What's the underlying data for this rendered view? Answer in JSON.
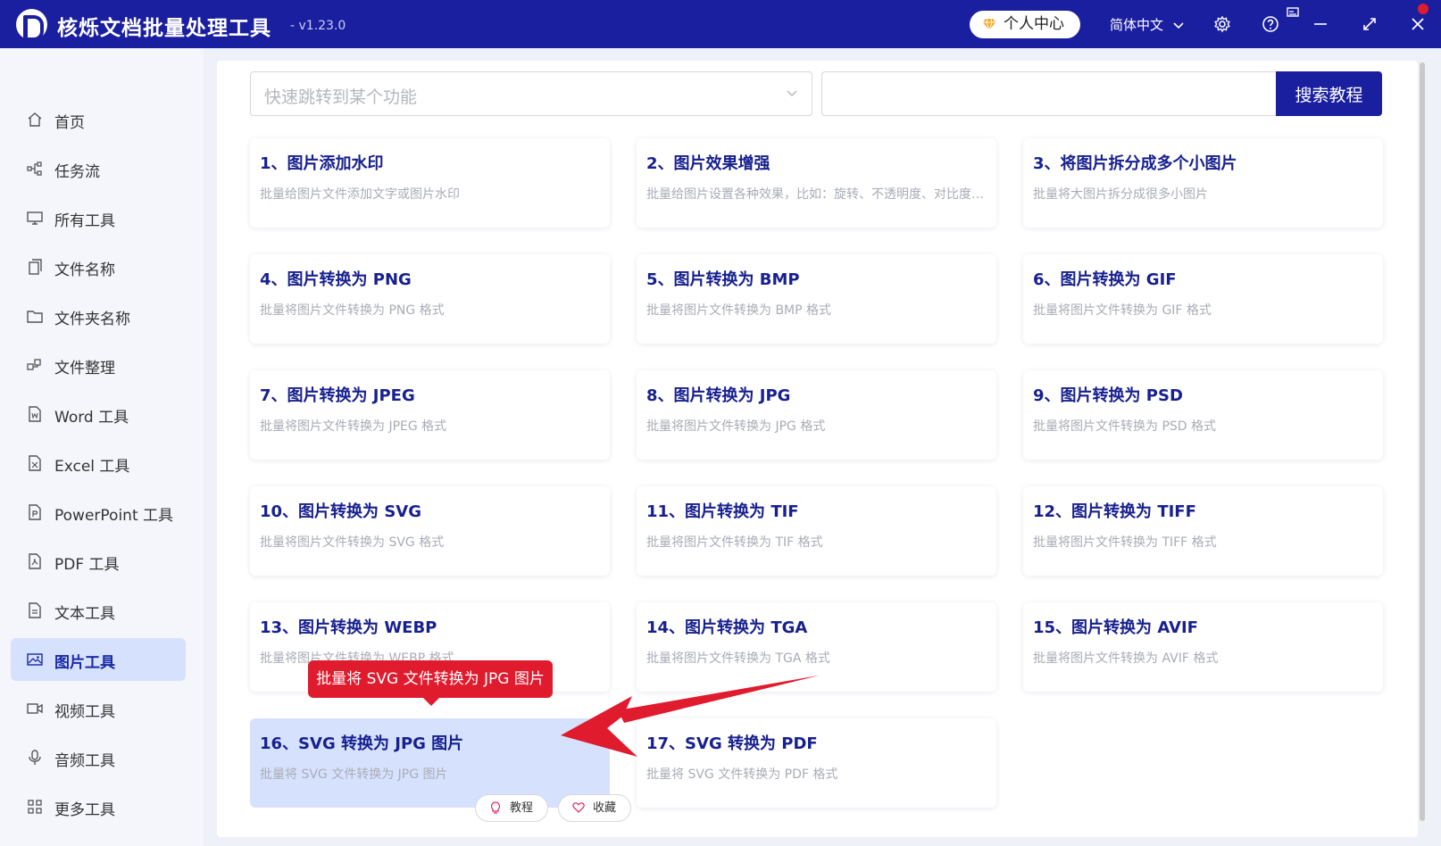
{
  "app": {
    "title": "核烁文档批量处理工具",
    "version": "- v1.23.0",
    "profile_label": "个人中心",
    "language": "简体中文"
  },
  "sidebar": {
    "items": [
      {
        "label": "首页",
        "icon": "home-icon"
      },
      {
        "label": "任务流",
        "icon": "workflow-icon"
      },
      {
        "label": "所有工具",
        "icon": "monitor-icon"
      },
      {
        "label": "文件名称",
        "icon": "file-copy-icon"
      },
      {
        "label": "文件夹名称",
        "icon": "folder-icon"
      },
      {
        "label": "文件整理",
        "icon": "organize-icon"
      },
      {
        "label": "Word 工具",
        "icon": "word-file-icon"
      },
      {
        "label": "Excel 工具",
        "icon": "excel-file-icon"
      },
      {
        "label": "PowerPoint 工具",
        "icon": "ppt-file-icon"
      },
      {
        "label": "PDF 工具",
        "icon": "pdf-file-icon"
      },
      {
        "label": "文本工具",
        "icon": "text-file-icon"
      },
      {
        "label": "图片工具",
        "icon": "image-icon",
        "active": true
      },
      {
        "label": "视频工具",
        "icon": "video-icon"
      },
      {
        "label": "音频工具",
        "icon": "microphone-icon"
      },
      {
        "label": "更多工具",
        "icon": "grid-icon"
      }
    ]
  },
  "search": {
    "select_placeholder": "快速跳转到某个功能",
    "input_value": "",
    "button_label": "搜索教程"
  },
  "cards": [
    {
      "title": "1、图片添加水印",
      "desc": "批量给图片文件添加文字或图片水印"
    },
    {
      "title": "2、图片效果增强",
      "desc": "批量给图片设置各种效果，比如：旋转、不透明度、对比度、亮度等"
    },
    {
      "title": "3、将图片拆分成多个小图片",
      "desc": "批量将大图片拆分成很多小图片"
    },
    {
      "title": "4、图片转换为 PNG",
      "desc": "批量将图片文件转换为 PNG 格式"
    },
    {
      "title": "5、图片转换为 BMP",
      "desc": "批量将图片文件转换为 BMP 格式"
    },
    {
      "title": "6、图片转换为 GIF",
      "desc": "批量将图片文件转换为 GIF 格式"
    },
    {
      "title": "7、图片转换为 JPEG",
      "desc": "批量将图片文件转换为 JPEG 格式"
    },
    {
      "title": "8、图片转换为 JPG",
      "desc": "批量将图片文件转换为 JPG 格式"
    },
    {
      "title": "9、图片转换为 PSD",
      "desc": "批量将图片文件转换为 PSD 格式"
    },
    {
      "title": "10、图片转换为 SVG",
      "desc": "批量将图片文件转换为 SVG 格式"
    },
    {
      "title": "11、图片转换为 TIF",
      "desc": "批量将图片文件转换为 TIF 格式"
    },
    {
      "title": "12、图片转换为 TIFF",
      "desc": "批量将图片文件转换为 TIFF 格式"
    },
    {
      "title": "13、图片转换为 WEBP",
      "desc": "批量将图片文件转换为 WEBP 格式"
    },
    {
      "title": "14、图片转换为 TGA",
      "desc": "批量将图片文件转换为 TGA 格式"
    },
    {
      "title": "15、图片转换为 AVIF",
      "desc": "批量将图片文件转换为 AVIF 格式"
    },
    {
      "title": "16、SVG 转换为 JPG 图片",
      "desc": "批量将 SVG 文件转换为 JPG 图片",
      "highlighted": true
    },
    {
      "title": "17、SVG 转换为 PDF",
      "desc": "批量将 SVG 文件转换为 PDF 格式"
    }
  ],
  "card_actions": {
    "tutorial_label": "教程",
    "favorite_label": "收藏"
  },
  "tooltip": {
    "text": "批量将 SVG 文件转换为 JPG 图片"
  },
  "colors": {
    "brand": "#1a1fa0",
    "title_text": "#17208f",
    "active_bg": "#d6e2fd",
    "tooltip_bg": "#e01b2e",
    "profile_icon": "#f5a623"
  }
}
